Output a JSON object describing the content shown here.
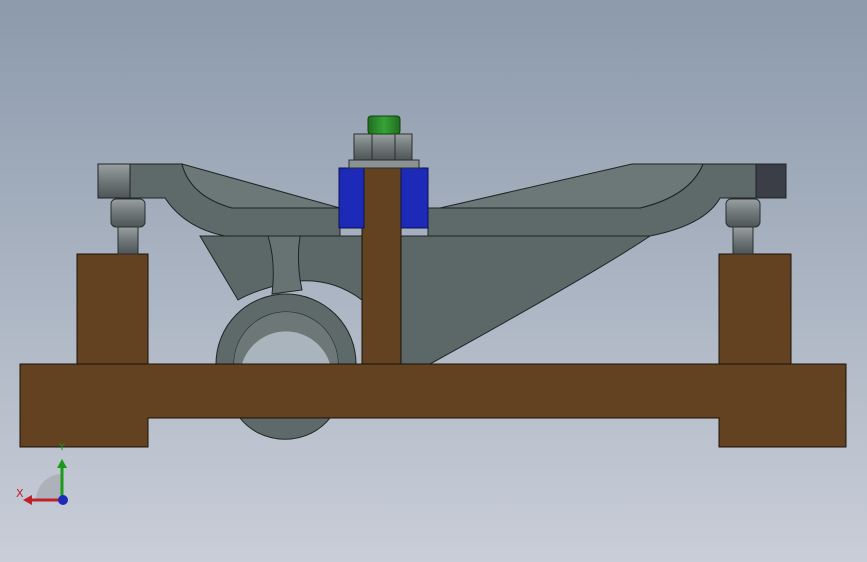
{
  "scene": {
    "background_top": "#8c9aac",
    "background_bottom": "#c9ced8"
  },
  "materials": {
    "fixture": "#634221",
    "part": "#5d6a69",
    "part_dark": "#3f4a49",
    "clamp_blocks": "#1d2ab8",
    "hardware": "#7d8586",
    "nut_cap": "#2a8a2a",
    "end_cap": "#3b3d47"
  },
  "triad": {
    "x_label": "X",
    "y_label": "Y",
    "x_color": "#c0202a",
    "y_color": "#1c9a1c",
    "z_color": "#1d2ab8"
  }
}
